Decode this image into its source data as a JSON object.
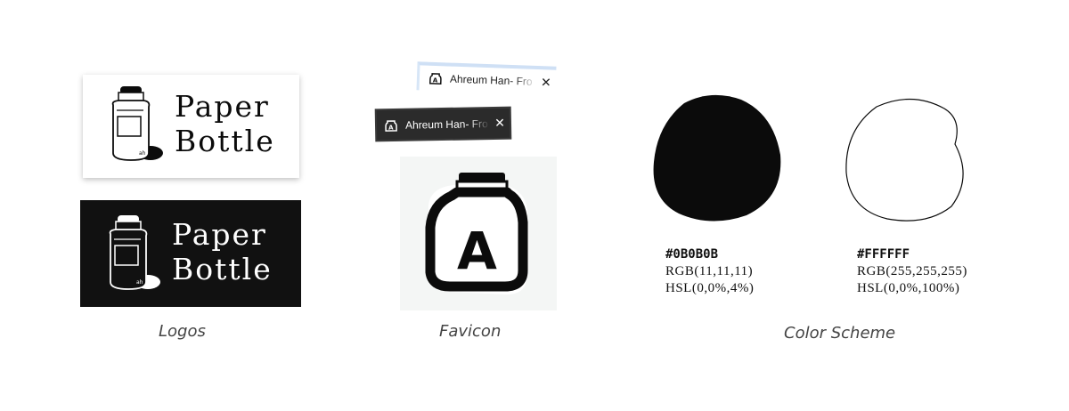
{
  "logos": {
    "wordmark_line1": "Paper",
    "wordmark_line2": "Bottle",
    "caption": "Logos"
  },
  "favicon": {
    "tab_title": "Ahreum Han- Fro",
    "close_glyph": "✕",
    "icon_letter": "A",
    "caption": "Favicon"
  },
  "colors": {
    "caption": "Color Scheme",
    "swatches": [
      {
        "hex": "#0B0B0B",
        "rgb": "RGB(11,11,11)",
        "hsl": "HSL(0,0%,4%)",
        "color": "#0b0b0b"
      },
      {
        "hex": "#FFFFFF",
        "rgb": "RGB(255,255,255)",
        "hsl": "HSL(0,0%,100%)",
        "color": "#ffffff"
      }
    ]
  }
}
